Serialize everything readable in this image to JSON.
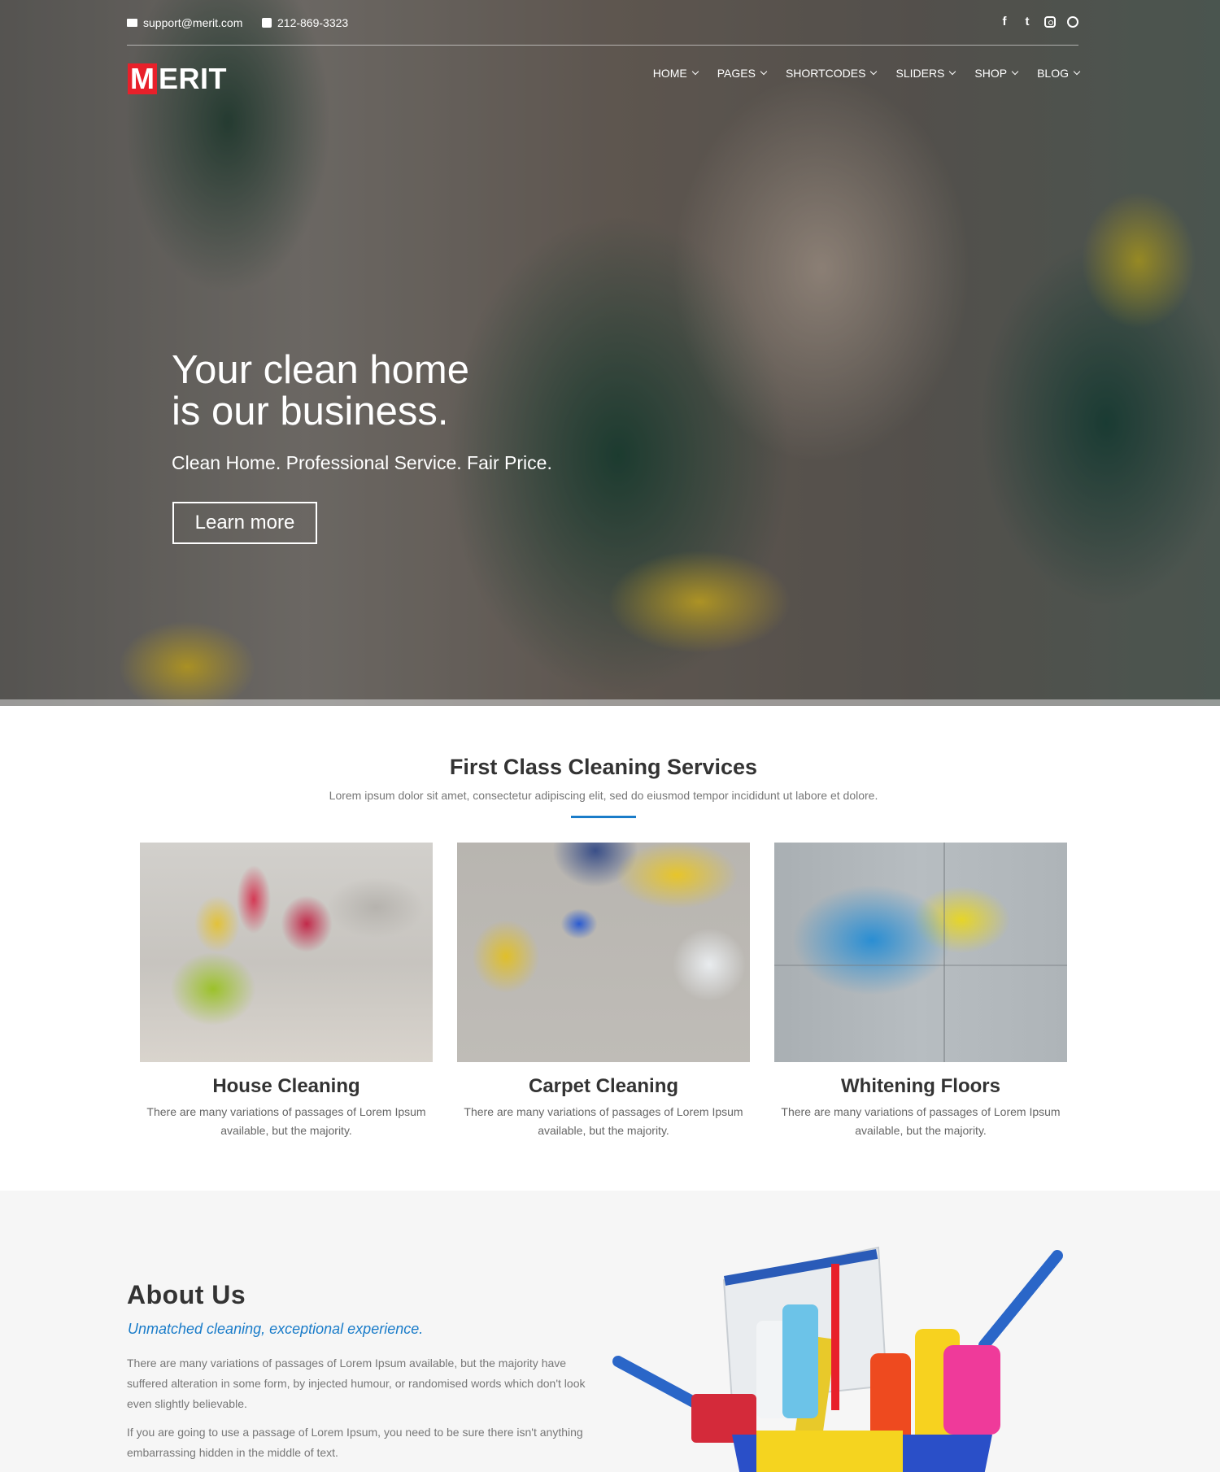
{
  "topbar": {
    "email": "support@merit.com",
    "phone": "212-869-3323",
    "socials": [
      "facebook-icon",
      "twitter-icon",
      "instagram-icon",
      "dribbble-icon"
    ],
    "socials_text": {
      "facebook": "f",
      "twitter": "t"
    }
  },
  "logo": {
    "m": "M",
    "rest": "ERIT"
  },
  "nav": {
    "items": [
      {
        "label": "HOME"
      },
      {
        "label": "PAGES"
      },
      {
        "label": "SHORTCODES"
      },
      {
        "label": "SLIDERS"
      },
      {
        "label": "SHOP"
      },
      {
        "label": "BLOG"
      }
    ]
  },
  "hero": {
    "title_line1": "Your clean home",
    "title_line2": "is our business.",
    "subtitle": "Clean Home. Professional Service. Fair Price.",
    "button": "Learn more"
  },
  "services": {
    "title": "First Class Cleaning Services",
    "subtitle": "Lorem ipsum dolor sit amet, consectetur adipiscing elit, sed do eiusmod tempor incididunt ut labore et dolore.",
    "cards": [
      {
        "title": "House Cleaning",
        "text": "There are many variations of passages of Lorem Ipsum available, but the majority."
      },
      {
        "title": "Carpet Cleaning",
        "text": "There are many variations of passages of Lorem Ipsum available, but the majority."
      },
      {
        "title": "Whitening Floors",
        "text": "There are many variations of passages of Lorem Ipsum available, but the majority."
      }
    ]
  },
  "about": {
    "title": "About Us",
    "subtitle": "Unmatched cleaning, exceptional experience.",
    "p1": "There are many variations of passages of Lorem Ipsum available, but the majority have suffered alteration in some form, by injected humour, or randomised words which don't look even slightly believable.",
    "p2": "If you are going to use a passage of Lorem Ipsum, you need to be sure there isn't anything embarrassing hidden in the middle of text."
  },
  "colors": {
    "accent": "#1a7cc9",
    "logo_red": "#e8202a"
  }
}
